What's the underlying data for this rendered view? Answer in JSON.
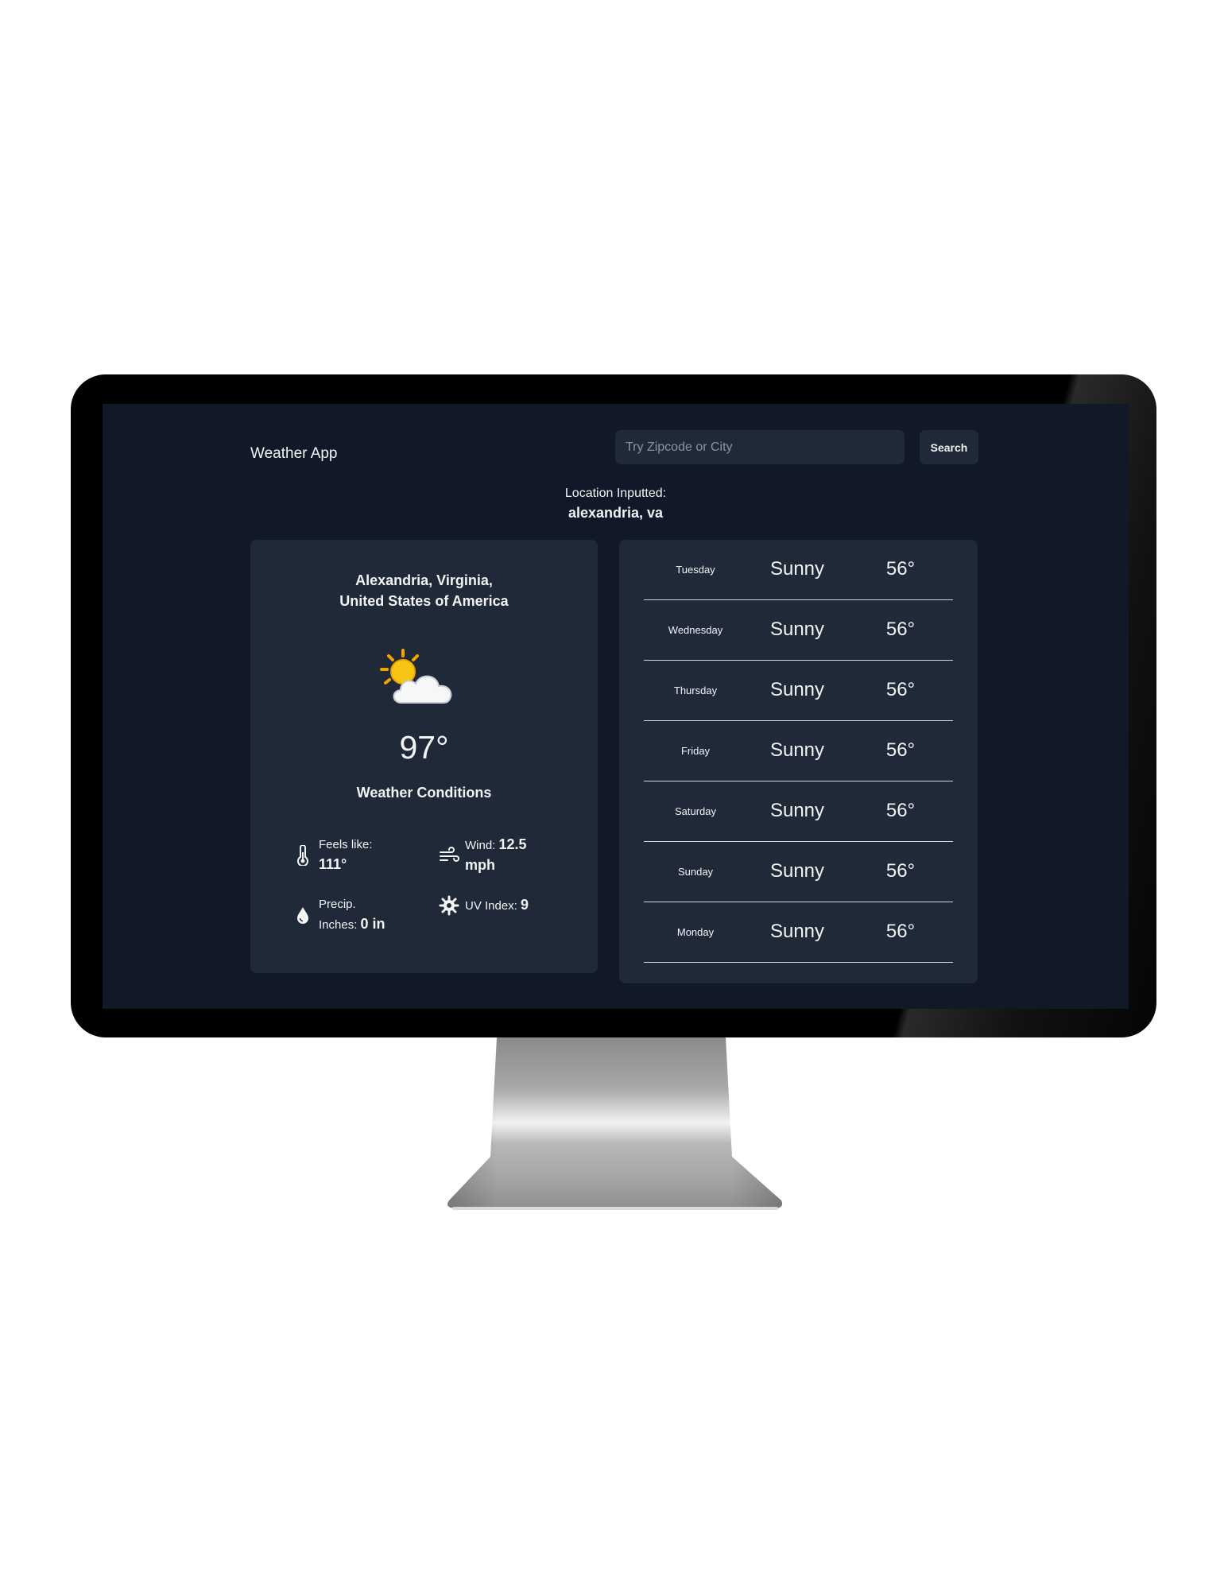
{
  "app": {
    "title": "Weather App"
  },
  "search": {
    "placeholder": "Try Zipcode or City",
    "value": "",
    "button_label": "Search"
  },
  "location": {
    "label": "Location Inputted:",
    "value": "alexandria, va"
  },
  "current": {
    "city_line1": "Alexandria, Virginia,",
    "city_line2": "United States of America",
    "icon": "partly-cloudy-icon",
    "temperature": "97°",
    "conditions_label": "Weather Conditions",
    "feels_like_label": "Feels like:",
    "feels_like_value": "111°",
    "wind_label": "Wind:",
    "wind_value": "12.5",
    "wind_unit": "mph",
    "precip_label_line1": "Precip.",
    "precip_label_line2": "Inches:",
    "precip_value": "0 in",
    "uv_label": "UV Index:",
    "uv_value": "9"
  },
  "forecast": [
    {
      "day": "Tuesday",
      "condition": "Sunny",
      "temp": "56°"
    },
    {
      "day": "Wednesday",
      "condition": "Sunny",
      "temp": "56°"
    },
    {
      "day": "Thursday",
      "condition": "Sunny",
      "temp": "56°"
    },
    {
      "day": "Friday",
      "condition": "Sunny",
      "temp": "56°"
    },
    {
      "day": "Saturday",
      "condition": "Sunny",
      "temp": "56°"
    },
    {
      "day": "Sunday",
      "condition": "Sunny",
      "temp": "56°"
    },
    {
      "day": "Monday",
      "condition": "Sunny",
      "temp": "56°"
    }
  ],
  "colors": {
    "screen_background": "#111827",
    "card_background": "#1f2937",
    "text": "#f3f4f6",
    "divider": "#d1d5db",
    "sun": "#f5b400"
  }
}
